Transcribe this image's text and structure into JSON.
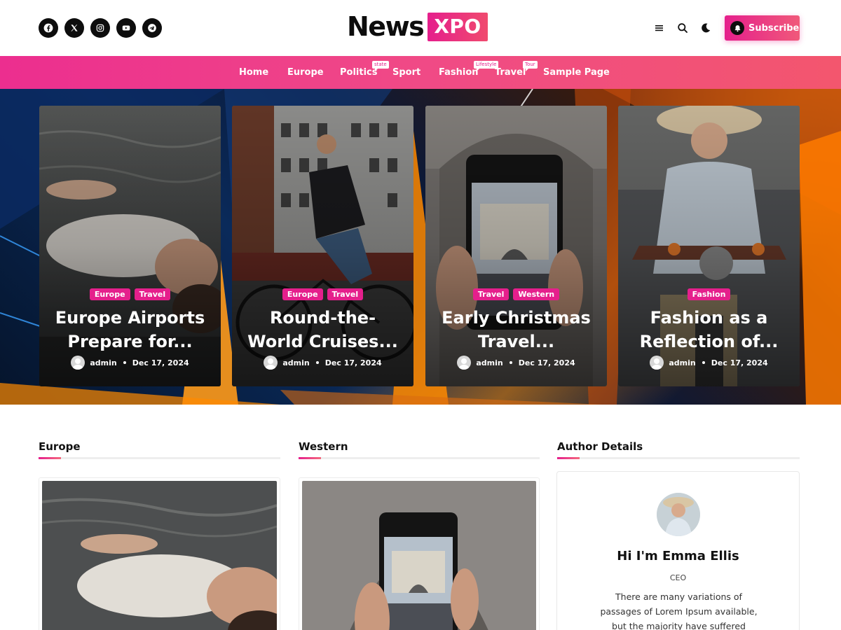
{
  "header": {
    "logo_main": "News",
    "logo_badge": "XPO",
    "social_icons": [
      "facebook-icon",
      "x-twitter-icon",
      "instagram-icon",
      "youtube-icon",
      "telegram-icon"
    ],
    "subscribe_label": "Subscribe"
  },
  "nav": {
    "items": [
      {
        "label": "Home"
      },
      {
        "label": "Europe"
      },
      {
        "label": "Politics",
        "tag": "state"
      },
      {
        "label": "Sport"
      },
      {
        "label": "Fashion",
        "tag": "Lifestyle"
      },
      {
        "label": "Travel",
        "tag": "Tour"
      },
      {
        "label": "Sample Page"
      }
    ]
  },
  "hero": {
    "cards": [
      {
        "cats": [
          "Europe",
          "Travel"
        ],
        "title_line1": "Europe Airports",
        "title_line2": "Prepare for...",
        "author": "admin",
        "date": "Dec 17, 2024"
      },
      {
        "cats": [
          "Europe",
          "Travel"
        ],
        "title_line1": "Round-the-",
        "title_line2": "World Cruises...",
        "author": "admin",
        "date": "Dec 17, 2024"
      },
      {
        "cats": [
          "Travel",
          "Western"
        ],
        "title_line1": "Early Christmas",
        "title_line2": "Travel...",
        "author": "admin",
        "date": "Dec 17, 2024"
      },
      {
        "cats": [
          "Fashion"
        ],
        "title_line1": "Fashion as a",
        "title_line2": "Reflection of...",
        "author": "admin",
        "date": "Dec 17, 2024"
      }
    ]
  },
  "sections": {
    "europe_title": "Europe",
    "western_title": "Western",
    "author_title": "Author Details"
  },
  "author": {
    "name": "Hi I'm Emma Ellis",
    "role": "CEO",
    "bio_line1": "There are many variations of",
    "bio_line2": "passages of Lorem Ipsum available,",
    "bio_line3": "but the majority have suffered"
  },
  "colors": {
    "brand_pink": "#e51f8c",
    "brand_coral": "#f3566e",
    "dark": "#0d0d0d"
  }
}
